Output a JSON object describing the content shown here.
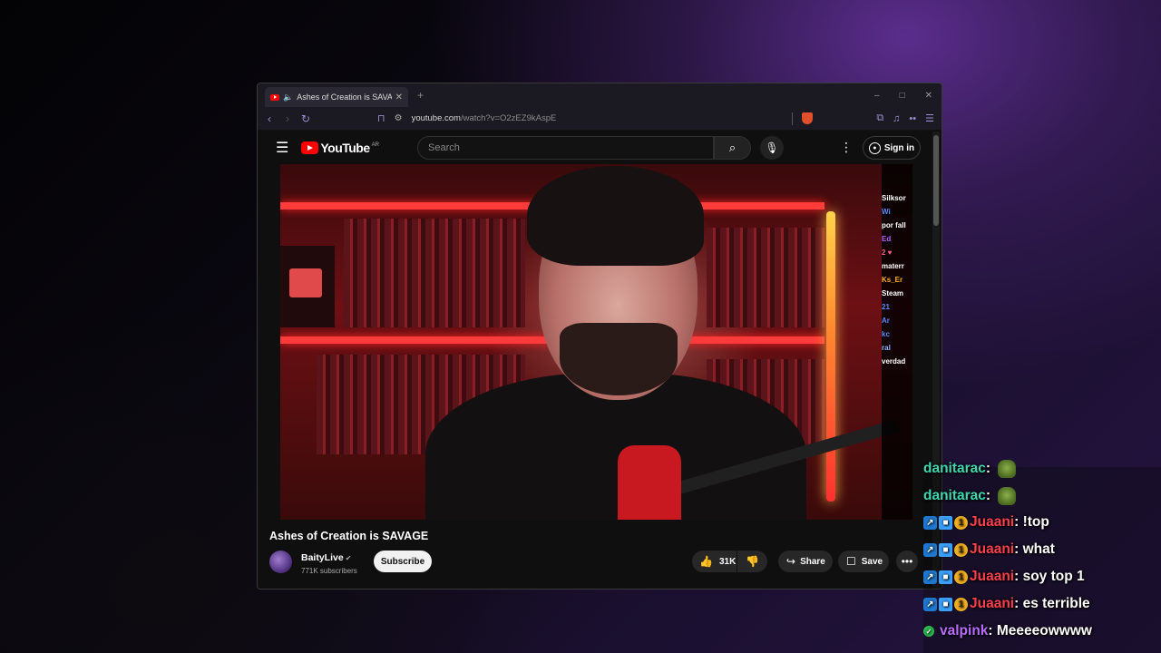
{
  "browser": {
    "tab_title": "Ashes of Creation is SAVAGE",
    "tab_close": "✕",
    "new_tab": "+",
    "url_host": "youtube.com",
    "url_path": "/watch?v=O2zEZ9kAspE",
    "window_controls": [
      "–",
      "□",
      "✕"
    ]
  },
  "youtube": {
    "logo_text": "YouTube",
    "country_code": "AR",
    "search_placeholder": "Search",
    "signin_label": "Sign in",
    "video_title": "Ashes of Creation is SAVAGE",
    "channel_name": "BaityLive",
    "subscribers": "771K subscribers",
    "subscribe_label": "Subscribe",
    "like_count": "31K",
    "share_label": "Share",
    "save_label": "Save"
  },
  "video_chat": [
    {
      "text": "Silksor",
      "color": "#ffffff"
    },
    {
      "text": "Wi",
      "color": "#5a8cff"
    },
    {
      "text": "por fall",
      "color": "#ffffff"
    },
    {
      "text": "Ed",
      "color": "#b45cff"
    },
    {
      "text": "2 ♥",
      "color": "#ff5a8c"
    },
    {
      "text": "materr",
      "color": "#ffffff"
    },
    {
      "text": "Ks_Er",
      "color": "#ffb020"
    },
    {
      "text": "Steam",
      "color": "#ffffff"
    },
    {
      "text": "21",
      "color": "#5a8cff"
    },
    {
      "text": "Ar",
      "color": "#5a8cff"
    },
    {
      "text": "kc",
      "color": "#5a8cff"
    },
    {
      "text": "ral",
      "color": "#8ab4ff"
    },
    {
      "text": "verdad",
      "color": "#ffffff"
    }
  ],
  "overlay_chat": [
    {
      "user": "danitarac",
      "color": "#3fd6b0",
      "msg": ":",
      "badges": [],
      "emote": true
    },
    {
      "user": "danitarac",
      "color": "#3fd6b0",
      "msg": ":",
      "badges": [],
      "emote": true
    },
    {
      "user": "Juaani",
      "color": "#ff3f4e",
      "msg": ": !top",
      "badges": [
        "prime",
        "cube",
        "one"
      ],
      "emote": false
    },
    {
      "user": "Juaani",
      "color": "#ff3f4e",
      "msg": ": what",
      "badges": [
        "prime",
        "cube",
        "one"
      ],
      "emote": false
    },
    {
      "user": "Juaani",
      "color": "#ff3f4e",
      "msg": ": soy top 1",
      "badges": [
        "prime",
        "cube",
        "one"
      ],
      "emote": false
    },
    {
      "user": "Juaani",
      "color": "#ff3f4e",
      "msg": ": es terrible",
      "badges": [
        "prime",
        "cube",
        "one"
      ],
      "emote": false
    },
    {
      "user": "valpink",
      "color": "#b86bff",
      "msg": ": Meeeeowwww",
      "badges": [
        "check"
      ],
      "emote": false
    }
  ]
}
